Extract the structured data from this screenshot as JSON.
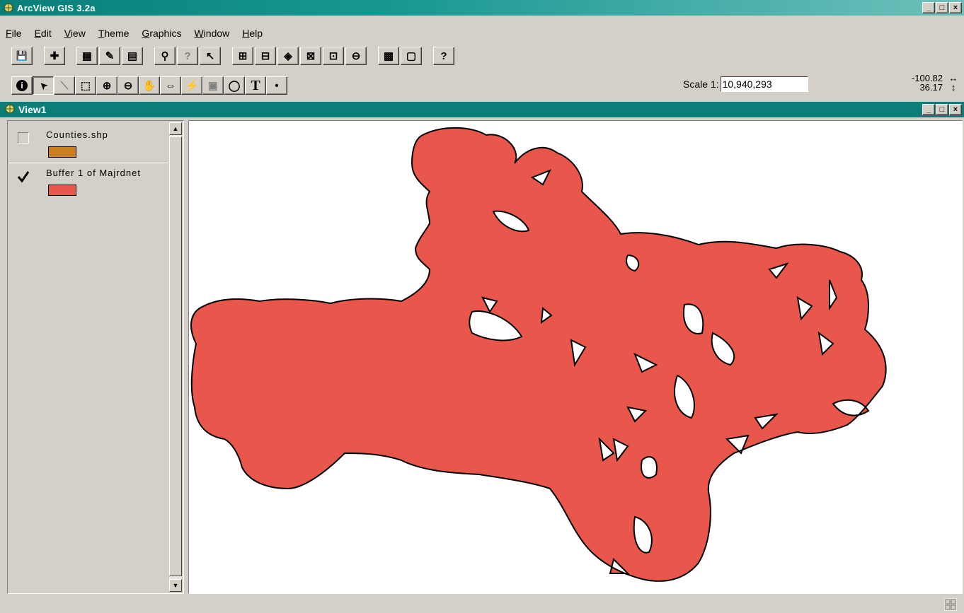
{
  "window": {
    "title": "ArcView GIS 3.2a",
    "controls": [
      "_",
      "□",
      "×"
    ]
  },
  "menu": {
    "items": [
      "File",
      "Edit",
      "View",
      "Theme",
      "Graphics",
      "Window",
      "Help"
    ]
  },
  "toolbar1": {
    "buttons": [
      {
        "name": "save-project",
        "glyph": "💾"
      },
      {
        "name": "add-theme",
        "glyph": "✚"
      },
      {
        "name": "theme-properties",
        "glyph": "▦"
      },
      {
        "name": "edit-legend",
        "glyph": "✎"
      },
      {
        "name": "open-theme-table",
        "glyph": "▤"
      },
      {
        "name": "find",
        "glyph": "⚲"
      },
      {
        "name": "locate-address",
        "glyph": "?"
      },
      {
        "name": "query-builder",
        "glyph": "↖"
      },
      {
        "name": "zoom-full-extent",
        "glyph": "⊞"
      },
      {
        "name": "zoom-active-themes",
        "glyph": "⊟"
      },
      {
        "name": "zoom-selected",
        "glyph": "◈"
      },
      {
        "name": "zoom-in-center",
        "glyph": "⊠"
      },
      {
        "name": "zoom-out-center",
        "glyph": "⊡"
      },
      {
        "name": "zoom-previous",
        "glyph": "⊖"
      },
      {
        "name": "select-by-theme",
        "glyph": "▩"
      },
      {
        "name": "clear-selection",
        "glyph": "▢"
      },
      {
        "name": "help",
        "glyph": "?"
      }
    ]
  },
  "toolbar2": {
    "buttons": [
      {
        "name": "identify",
        "glyph": "i"
      },
      {
        "name": "pointer",
        "glyph": "➤"
      },
      {
        "name": "vertex-edit",
        "glyph": "⟍"
      },
      {
        "name": "select-feature",
        "glyph": "⬚"
      },
      {
        "name": "zoom-in",
        "glyph": "⊕"
      },
      {
        "name": "zoom-out",
        "glyph": "⊖"
      },
      {
        "name": "pan",
        "glyph": "✋"
      },
      {
        "name": "measure",
        "glyph": "⇔"
      },
      {
        "name": "hot-link",
        "glyph": "⚡"
      },
      {
        "name": "area-of-interest",
        "glyph": "▣"
      },
      {
        "name": "label",
        "glyph": "◯"
      },
      {
        "name": "text",
        "glyph": "T"
      },
      {
        "name": "draw-point",
        "glyph": "•"
      }
    ]
  },
  "scale": {
    "label": "Scale 1:",
    "value": "10,940,293"
  },
  "coordinates": {
    "x": "-100.82",
    "y": "36.17"
  },
  "view": {
    "title": "View1",
    "controls": [
      "_",
      "□",
      "×"
    ]
  },
  "themes": [
    {
      "name": "Counties.shp",
      "visible": false,
      "color": "#c97f1f"
    },
    {
      "name": "Buffer 1 of Majrdnet",
      "visible": true,
      "color": "#e9564c"
    }
  ],
  "colors": {
    "title_bar": "#0a7f7a",
    "buffer_fill": "#e9564c",
    "counties_fill": "#c97f1f"
  }
}
